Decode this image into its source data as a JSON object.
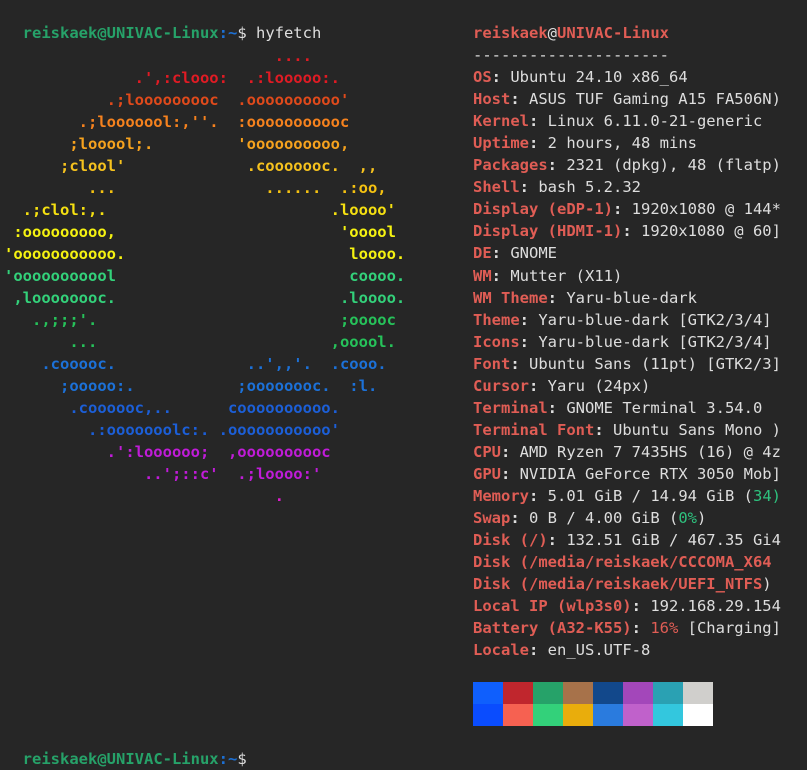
{
  "prompt": {
    "user_host": "reiskaek@UNIVAC-Linux",
    "path_suffix": ":~",
    "dollar": "$ ",
    "command": "hyfetch"
  },
  "info": {
    "title_user": "reiskaek",
    "title_at": "@",
    "title_host": "UNIVAC-Linux",
    "separator": "---------------------",
    "rows": [
      {
        "key": "OS",
        "value": "Ubuntu 24.10 x86_64"
      },
      {
        "key": "Host",
        "value": "ASUS TUF Gaming A15 FA506N)"
      },
      {
        "key": "Kernel",
        "value": "Linux 6.11.0-21-generic"
      },
      {
        "key": "Uptime",
        "value": "2 hours, 48 mins"
      },
      {
        "key": "Packages",
        "value": "2321 (dpkg), 48 (flatp)"
      },
      {
        "key": "Shell",
        "value": "bash 5.2.32"
      },
      {
        "key": "Display (eDP-1)",
        "value": "1920x1080 @ 144*"
      },
      {
        "key": "Display (HDMI-1)",
        "value": "1920x1080 @ 60]"
      },
      {
        "key": "DE",
        "value": "GNOME"
      },
      {
        "key": "WM",
        "value": "Mutter (X11)"
      },
      {
        "key": "WM Theme",
        "value": "Yaru-blue-dark"
      },
      {
        "key": "Theme",
        "value": "Yaru-blue-dark [GTK2/3/4]"
      },
      {
        "key": "Icons",
        "value": "Yaru-blue-dark [GTK2/3/4]"
      },
      {
        "key": "Font",
        "value": "Ubuntu Sans (11pt) [GTK2/3]"
      },
      {
        "key": "Cursor",
        "value": "Yaru (24px)"
      },
      {
        "key": "Terminal",
        "value": "GNOME Terminal 3.54.0"
      },
      {
        "key": "Terminal Font",
        "value": "Ubuntu Sans Mono )"
      },
      {
        "key": "CPU",
        "value": "AMD Ryzen 7 7435HS (16) @ 4z"
      },
      {
        "key": "GPU",
        "value": "NVIDIA GeForce RTX 3050 Mob]"
      }
    ],
    "memory": {
      "key": "Memory",
      "value": "5.01 GiB / 14.94 GiB (",
      "pct": "34)"
    },
    "swap": {
      "key": "Swap",
      "value": "0 B / 4.00 GiB (",
      "pct": "0%",
      ")": ")"
    },
    "disk_root": {
      "key": "Disk (/)",
      "value": "132.51 GiB / 467.35 Gi4"
    },
    "disk_cccoma": "Disk (/media/reiskaek/CCCOMA_X64",
    "disk_uefi": "Disk (/media/reiskaek/UEFI_NTFS",
    "disk_uefi_end": ")",
    "local_ip": {
      "key": "Local IP (wlp3s0)",
      "value": "192.168.29.154"
    },
    "battery": {
      "key": "Battery (A32-K55)",
      "pct": "16%",
      "state": " [Charging]"
    },
    "locale": {
      "key": "Locale",
      "value": "en_US.UTF-8"
    }
  },
  "ascii_art": [
    {
      "text": "                             ....",
      "color": "#e01b24"
    },
    {
      "text": "              .',:clooo:  .:looooo:.",
      "color": "#e01b24"
    },
    {
      "text": "           .;looooooooc  .oooooooooo'",
      "color": "#e04a1b"
    },
    {
      "text": "        .;looooool:,''.  :ooooooooooc",
      "color": "#f6821e"
    },
    {
      "text": "       ;looool;.         'oooooooooo,",
      "color": "#f6a21e"
    },
    {
      "text": "      ;clool'             .cooooooc.  ,,",
      "color": "#f6c21e"
    },
    {
      "text": "         ...                ......  .:oo,",
      "color": "#f5c211"
    },
    {
      "text": "  .;clol:,.                        .loooo'",
      "color": "#f5e011"
    },
    {
      "text": " :ooooooooo,                        'ooool",
      "color": "#f5f211"
    },
    {
      "text": "'ooooooooooo.                        loooo.",
      "color": "#f5f211"
    },
    {
      "text": "'ooooooooool                         coooo.",
      "color": "#33d17a"
    },
    {
      "text": " ,loooooooc.                        .loooo.",
      "color": "#33d17a"
    },
    {
      "text": "   .,;;;'.                          ;ooooc",
      "color": "#26c25a"
    },
    {
      "text": "       ...                         ,ooool.",
      "color": "#26c25a"
    },
    {
      "text": "    .cooooc.              ..',,'.  .cooo.",
      "color": "#1c71d8"
    },
    {
      "text": "      ;ooooo:.           ;oooooooc.  :l.",
      "color": "#1c71d8"
    },
    {
      "text": "       .coooooc,..      coooooooooo.",
      "color": "#1c5fd8"
    },
    {
      "text": "         .:ooooooolc:. .ooooooooooo'",
      "color": "#1c5fd8"
    },
    {
      "text": "           .':loooooo;  ,oooooooooc",
      "color": "#c01cd8"
    },
    {
      "text": "               ..';::c'  .;loooo:'",
      "color": "#c01cd8"
    },
    {
      "text": "                             .",
      "color": "#e01bd0"
    }
  ],
  "palette": {
    "row1": [
      "#0f5ffd",
      "#c0262d",
      "#26a269",
      "#a7724a",
      "#12488b",
      "#a347ba",
      "#2aa1b3",
      "#d0cfcc"
    ],
    "row2": [
      "#0a4cfe",
      "#f66151",
      "#33d17a",
      "#e9ad0c",
      "#2a7bde",
      "#c061cb",
      "#33c7de",
      "#ffffff"
    ]
  }
}
